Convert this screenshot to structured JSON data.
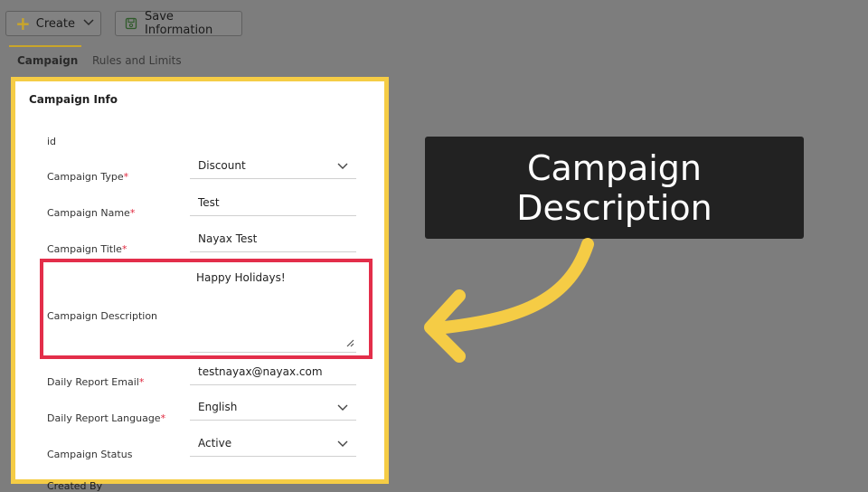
{
  "toolbar": {
    "create_label": "Create",
    "save_label": "Save Information"
  },
  "tabs": [
    {
      "label": "Campaign",
      "active": true
    },
    {
      "label": "Rules and Limits",
      "active": false
    }
  ],
  "panel": {
    "title": "Campaign Info",
    "fields": {
      "id": {
        "label": "id"
      },
      "type": {
        "label": "Campaign Type",
        "value": "Discount"
      },
      "name": {
        "label": "Campaign Name",
        "value": "Test"
      },
      "title": {
        "label": "Campaign Title",
        "value": "Nayax Test"
      },
      "description": {
        "label": "Campaign Description",
        "value": "Happy Holidays!"
      },
      "email": {
        "label": "Daily Report Email",
        "value": "testnayax@nayax.com"
      },
      "language": {
        "label": "Daily Report Language",
        "value": "English"
      },
      "status": {
        "label": "Campaign Status",
        "value": "Active"
      },
      "created_by": {
        "label": "Created By"
      }
    }
  },
  "callout": {
    "line1": "Campaign",
    "line2": "Description"
  },
  "colors": {
    "panel_border": "#f5cc45",
    "highlight_border": "#e32e4a",
    "arrow": "#f5cc45",
    "required_star": "#e0283e",
    "accent": "#c9a52a"
  },
  "icons": [
    "plus-icon",
    "chevron-down-icon",
    "save-icon",
    "resize-handle-icon",
    "curved-arrow-icon"
  ]
}
